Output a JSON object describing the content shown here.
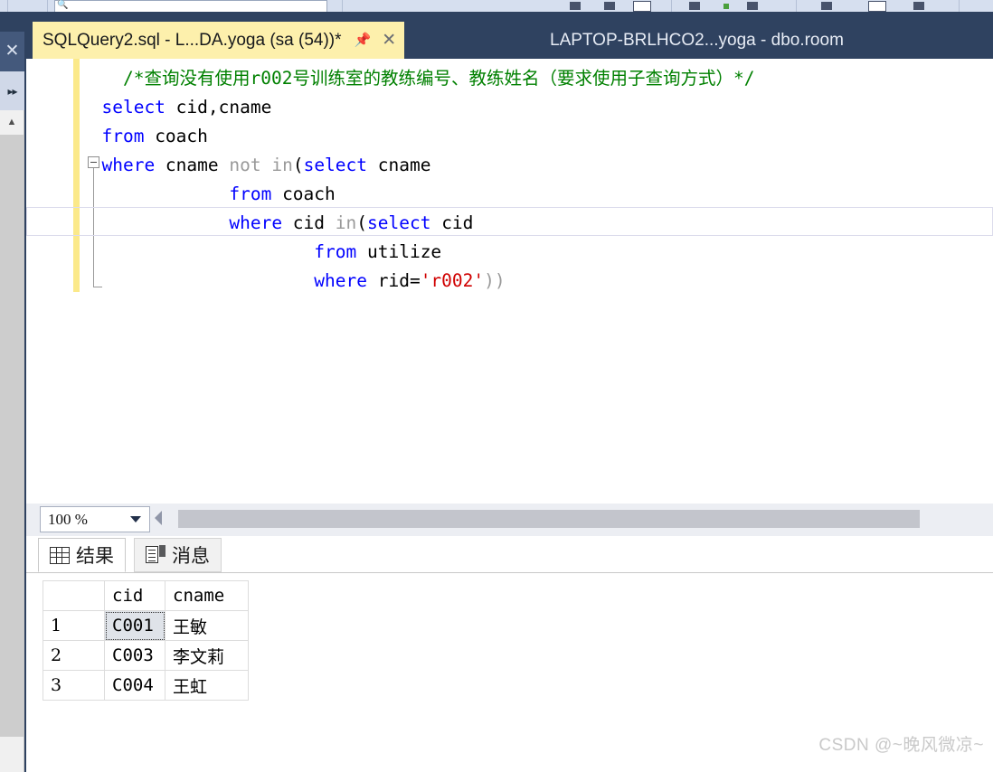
{
  "toolbar": {
    "search_placeholder": "",
    "search_icon": "magnifier-icon"
  },
  "tabs": {
    "active": {
      "label": "SQLQuery2.sql - L...DA.yoga (sa (54))*",
      "pin_icon": "pin-icon",
      "close_icon": "close-icon"
    },
    "inactive": {
      "label": "LAPTOP-BRLHCO2...yoga - dbo.room"
    }
  },
  "dock": {
    "close_label": "✕",
    "expand_label": "▸▸"
  },
  "editor": {
    "zoom_value": "100 %",
    "lines": [
      {
        "id": "line-comment",
        "tokens": [
          {
            "cls": "cmt",
            "text": "    /*"
          },
          {
            "cls": "cmt cn",
            "text": "查询没有使用"
          },
          {
            "cls": "cmt",
            "text": "r002"
          },
          {
            "cls": "cmt cn",
            "text": "号训练室的教练编号、教练姓名（要求使用子查询方式）"
          },
          {
            "cls": "cmt",
            "text": "*/"
          }
        ]
      },
      {
        "id": "line-select",
        "tokens": [
          {
            "cls": "kw",
            "text": "  select"
          },
          {
            "cls": "pln",
            "text": " cid,cname"
          }
        ]
      },
      {
        "id": "line-from",
        "tokens": [
          {
            "cls": "kw",
            "text": "  from"
          },
          {
            "cls": "pln",
            "text": " coach"
          }
        ]
      },
      {
        "id": "line-where-cname",
        "tokens": [
          {
            "cls": "kw",
            "text": "  where"
          },
          {
            "cls": "pln",
            "text": " cname "
          },
          {
            "cls": "gray",
            "text": "not in"
          },
          {
            "cls": "pln",
            "text": "("
          },
          {
            "cls": "kw",
            "text": "select"
          },
          {
            "cls": "pln",
            "text": " cname"
          }
        ]
      },
      {
        "id": "line-sub-from-coach",
        "tokens": [
          {
            "cls": "kw",
            "text": "              from"
          },
          {
            "cls": "pln",
            "text": " coach"
          }
        ]
      },
      {
        "id": "line-sub-where-cid",
        "tokens": [
          {
            "cls": "kw",
            "text": "              where"
          },
          {
            "cls": "pln",
            "text": " cid "
          },
          {
            "cls": "gray",
            "text": "in"
          },
          {
            "cls": "pln",
            "text": "("
          },
          {
            "cls": "kw",
            "text": "select"
          },
          {
            "cls": "pln",
            "text": " cid"
          }
        ]
      },
      {
        "id": "line-sub2-from",
        "tokens": [
          {
            "cls": "kw",
            "text": "                      from"
          },
          {
            "cls": "pln",
            "text": " utilize"
          }
        ]
      },
      {
        "id": "line-sub2-where",
        "tokens": [
          {
            "cls": "kw",
            "text": "                      where"
          },
          {
            "cls": "pln",
            "text": " rid="
          },
          {
            "cls": "str",
            "text": "'r002'"
          },
          {
            "cls": "gray",
            "text": "))"
          }
        ]
      }
    ],
    "current_line_index": 5
  },
  "results": {
    "tabs": [
      {
        "label": "结果",
        "icon": "grid-icon",
        "selected": true
      },
      {
        "label": "消息",
        "icon": "message-icon",
        "selected": false
      }
    ],
    "columns": [
      "",
      "cid",
      "cname"
    ],
    "rows": [
      {
        "num": "1",
        "cid": "C001",
        "cname": "王敏",
        "selected_cell": "cid"
      },
      {
        "num": "2",
        "cid": "C003",
        "cname": "李文莉",
        "selected_cell": ""
      },
      {
        "num": "3",
        "cid": "C004",
        "cname": "王虹",
        "selected_cell": ""
      }
    ]
  },
  "watermark": {
    "text": "CSDN @~晚风微凉~"
  },
  "colors": {
    "chrome": "#2f4260",
    "active_tab": "#fdf0ac",
    "keyword": "#0000ff",
    "comment": "#008000",
    "string": "#d00000",
    "gray_token": "#9a9a9a",
    "change_bar": "#fbe98a"
  }
}
